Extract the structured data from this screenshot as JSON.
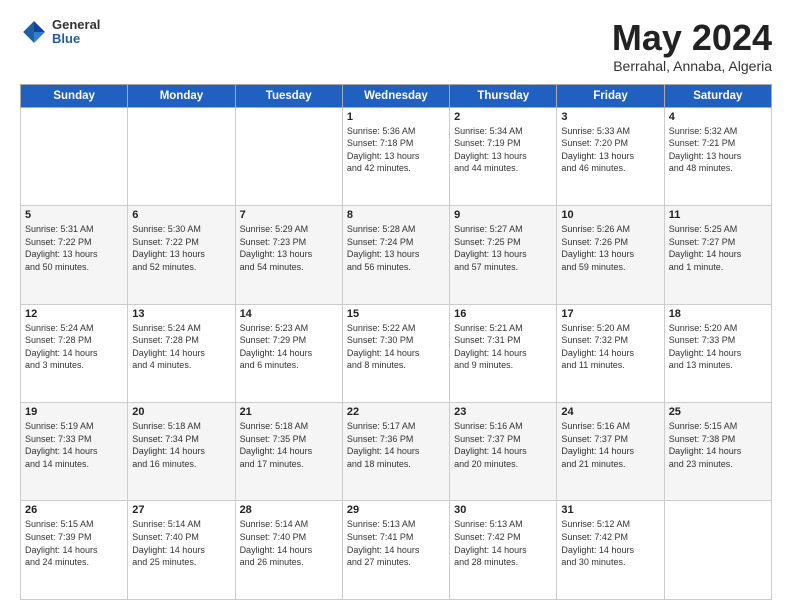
{
  "header": {
    "logo_general": "General",
    "logo_blue": "Blue",
    "month_title": "May 2024",
    "location": "Berrahal, Annaba, Algeria"
  },
  "days_of_week": [
    "Sunday",
    "Monday",
    "Tuesday",
    "Wednesday",
    "Thursday",
    "Friday",
    "Saturday"
  ],
  "weeks": [
    [
      {
        "day": "",
        "info": ""
      },
      {
        "day": "",
        "info": ""
      },
      {
        "day": "",
        "info": ""
      },
      {
        "day": "1",
        "info": "Sunrise: 5:36 AM\nSunset: 7:18 PM\nDaylight: 13 hours\nand 42 minutes."
      },
      {
        "day": "2",
        "info": "Sunrise: 5:34 AM\nSunset: 7:19 PM\nDaylight: 13 hours\nand 44 minutes."
      },
      {
        "day": "3",
        "info": "Sunrise: 5:33 AM\nSunset: 7:20 PM\nDaylight: 13 hours\nand 46 minutes."
      },
      {
        "day": "4",
        "info": "Sunrise: 5:32 AM\nSunset: 7:21 PM\nDaylight: 13 hours\nand 48 minutes."
      }
    ],
    [
      {
        "day": "5",
        "info": "Sunrise: 5:31 AM\nSunset: 7:22 PM\nDaylight: 13 hours\nand 50 minutes."
      },
      {
        "day": "6",
        "info": "Sunrise: 5:30 AM\nSunset: 7:22 PM\nDaylight: 13 hours\nand 52 minutes."
      },
      {
        "day": "7",
        "info": "Sunrise: 5:29 AM\nSunset: 7:23 PM\nDaylight: 13 hours\nand 54 minutes."
      },
      {
        "day": "8",
        "info": "Sunrise: 5:28 AM\nSunset: 7:24 PM\nDaylight: 13 hours\nand 56 minutes."
      },
      {
        "day": "9",
        "info": "Sunrise: 5:27 AM\nSunset: 7:25 PM\nDaylight: 13 hours\nand 57 minutes."
      },
      {
        "day": "10",
        "info": "Sunrise: 5:26 AM\nSunset: 7:26 PM\nDaylight: 13 hours\nand 59 minutes."
      },
      {
        "day": "11",
        "info": "Sunrise: 5:25 AM\nSunset: 7:27 PM\nDaylight: 14 hours\nand 1 minute."
      }
    ],
    [
      {
        "day": "12",
        "info": "Sunrise: 5:24 AM\nSunset: 7:28 PM\nDaylight: 14 hours\nand 3 minutes."
      },
      {
        "day": "13",
        "info": "Sunrise: 5:24 AM\nSunset: 7:28 PM\nDaylight: 14 hours\nand 4 minutes."
      },
      {
        "day": "14",
        "info": "Sunrise: 5:23 AM\nSunset: 7:29 PM\nDaylight: 14 hours\nand 6 minutes."
      },
      {
        "day": "15",
        "info": "Sunrise: 5:22 AM\nSunset: 7:30 PM\nDaylight: 14 hours\nand 8 minutes."
      },
      {
        "day": "16",
        "info": "Sunrise: 5:21 AM\nSunset: 7:31 PM\nDaylight: 14 hours\nand 9 minutes."
      },
      {
        "day": "17",
        "info": "Sunrise: 5:20 AM\nSunset: 7:32 PM\nDaylight: 14 hours\nand 11 minutes."
      },
      {
        "day": "18",
        "info": "Sunrise: 5:20 AM\nSunset: 7:33 PM\nDaylight: 14 hours\nand 13 minutes."
      }
    ],
    [
      {
        "day": "19",
        "info": "Sunrise: 5:19 AM\nSunset: 7:33 PM\nDaylight: 14 hours\nand 14 minutes."
      },
      {
        "day": "20",
        "info": "Sunrise: 5:18 AM\nSunset: 7:34 PM\nDaylight: 14 hours\nand 16 minutes."
      },
      {
        "day": "21",
        "info": "Sunrise: 5:18 AM\nSunset: 7:35 PM\nDaylight: 14 hours\nand 17 minutes."
      },
      {
        "day": "22",
        "info": "Sunrise: 5:17 AM\nSunset: 7:36 PM\nDaylight: 14 hours\nand 18 minutes."
      },
      {
        "day": "23",
        "info": "Sunrise: 5:16 AM\nSunset: 7:37 PM\nDaylight: 14 hours\nand 20 minutes."
      },
      {
        "day": "24",
        "info": "Sunrise: 5:16 AM\nSunset: 7:37 PM\nDaylight: 14 hours\nand 21 minutes."
      },
      {
        "day": "25",
        "info": "Sunrise: 5:15 AM\nSunset: 7:38 PM\nDaylight: 14 hours\nand 23 minutes."
      }
    ],
    [
      {
        "day": "26",
        "info": "Sunrise: 5:15 AM\nSunset: 7:39 PM\nDaylight: 14 hours\nand 24 minutes."
      },
      {
        "day": "27",
        "info": "Sunrise: 5:14 AM\nSunset: 7:40 PM\nDaylight: 14 hours\nand 25 minutes."
      },
      {
        "day": "28",
        "info": "Sunrise: 5:14 AM\nSunset: 7:40 PM\nDaylight: 14 hours\nand 26 minutes."
      },
      {
        "day": "29",
        "info": "Sunrise: 5:13 AM\nSunset: 7:41 PM\nDaylight: 14 hours\nand 27 minutes."
      },
      {
        "day": "30",
        "info": "Sunrise: 5:13 AM\nSunset: 7:42 PM\nDaylight: 14 hours\nand 28 minutes."
      },
      {
        "day": "31",
        "info": "Sunrise: 5:12 AM\nSunset: 7:42 PM\nDaylight: 14 hours\nand 30 minutes."
      },
      {
        "day": "",
        "info": ""
      }
    ]
  ]
}
